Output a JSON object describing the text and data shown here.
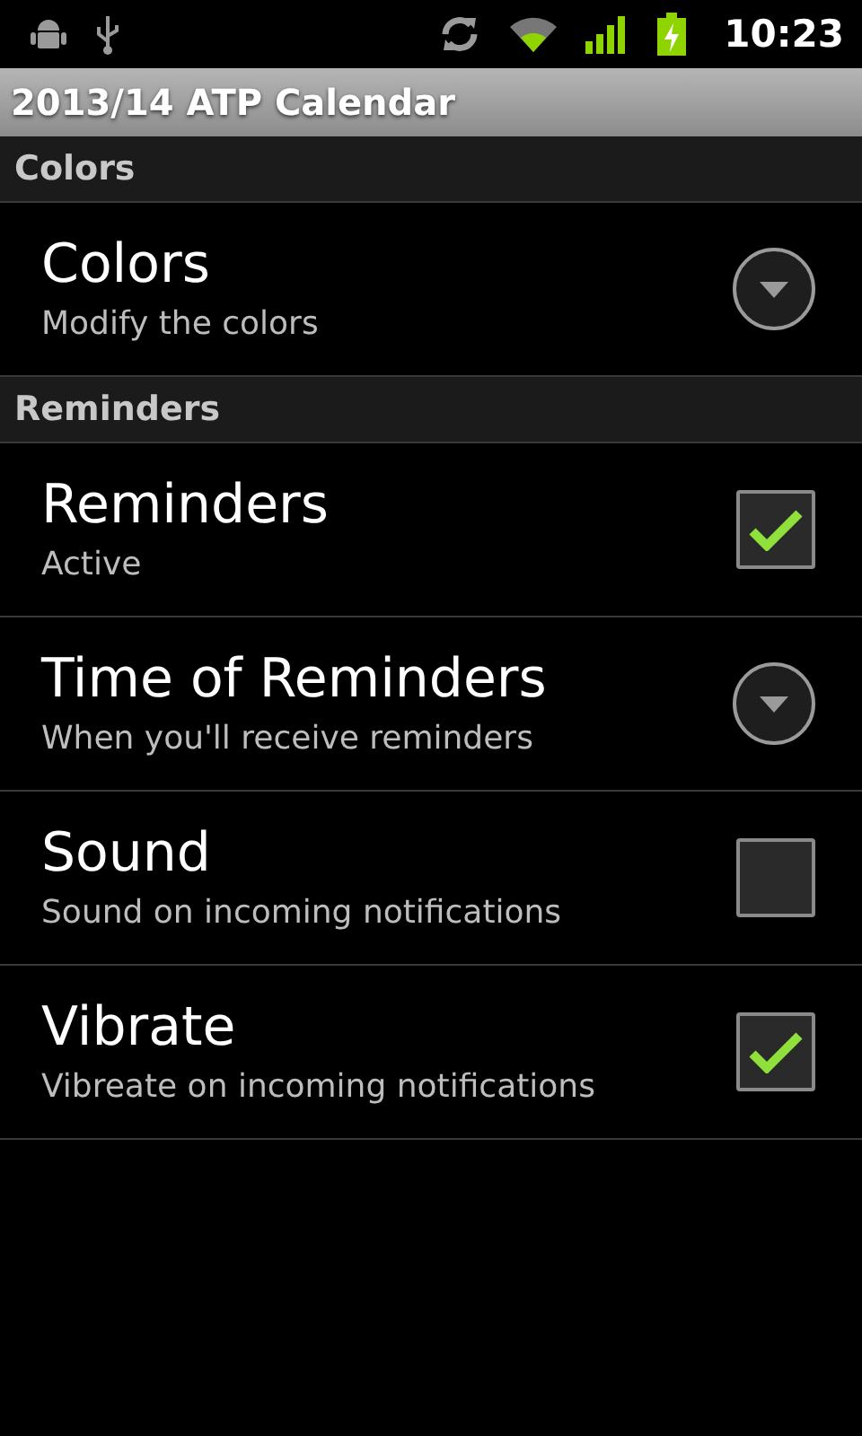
{
  "status_bar": {
    "time": "10:23"
  },
  "window": {
    "title": "2013/14 ATP Calendar"
  },
  "sections": [
    {
      "header": "Colors",
      "items": [
        {
          "kind": "list",
          "title": "Colors",
          "summary": "Modify the colors"
        }
      ]
    },
    {
      "header": "Reminders",
      "items": [
        {
          "kind": "checkbox",
          "title": "Reminders",
          "summary": "Active",
          "checked": true
        },
        {
          "kind": "list",
          "title": "Time of Reminders",
          "summary": "When you'll receive reminders"
        },
        {
          "kind": "checkbox",
          "title": "Sound",
          "summary": "Sound on incoming notifications",
          "checked": false
        },
        {
          "kind": "checkbox",
          "title": "Vibrate",
          "summary": "Vibreate on incoming notifications",
          "checked": true
        }
      ]
    }
  ]
}
